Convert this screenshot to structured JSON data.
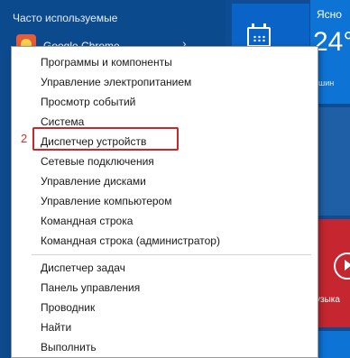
{
  "start_menu": {
    "section_title": "Часто используемые",
    "first_app_label": "Google Chrome"
  },
  "tiles": {
    "weather_label": "Ясно",
    "temperature": "24°",
    "weather_sub": "шин",
    "music_label": "узыка"
  },
  "context_menu": {
    "group1": [
      "Программы и компоненты",
      "Управление электропитанием",
      "Просмотр событий",
      "Система",
      "Диспетчер устройств",
      "Сетевые подключения",
      "Управление дисками",
      "Управление компьютером",
      "Командная строка",
      "Командная строка (администратор)"
    ],
    "group2": [
      "Диспетчер задач",
      "Панель управления",
      "Проводник",
      "Найти",
      "Выполнить"
    ]
  },
  "annotation": {
    "step_number": "2",
    "highlight_color": "#c6282c"
  },
  "colors": {
    "start_bg": "#0c4a8e",
    "tile_blue": "#0a64c8",
    "tile_red": "#c5262f",
    "menu_bg": "#ffffff"
  },
  "icons": [
    "calendar-icon",
    "app-icon",
    "chevron-right-icon",
    "music-icon"
  ]
}
